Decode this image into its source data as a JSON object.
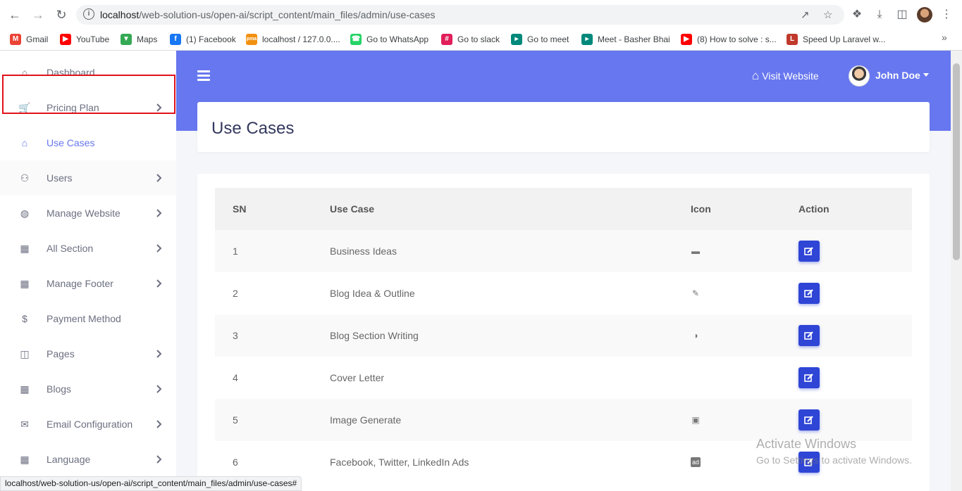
{
  "browser": {
    "url_host": "localhost",
    "url_path": "/web-solution-us/open-ai/script_content/main_files/admin/use-cases",
    "bookmarks": [
      {
        "label": "Gmail",
        "icon": "gmail-icon",
        "color": "#ea4335"
      },
      {
        "label": "YouTube",
        "icon": "youtube-icon",
        "color": "#ff0000"
      },
      {
        "label": "Maps",
        "icon": "maps-icon",
        "color": "#34a853"
      },
      {
        "label": "(1) Facebook",
        "icon": "facebook-icon",
        "color": "#1877f2"
      },
      {
        "label": "localhost / 127.0.0....",
        "icon": "phpmyadmin-icon",
        "color": "#f29111"
      },
      {
        "label": "Go to WhatsApp",
        "icon": "whatsapp-icon",
        "color": "#25d366"
      },
      {
        "label": "Go to slack",
        "icon": "slack-icon",
        "color": "#e01e5a"
      },
      {
        "label": "Go to meet",
        "icon": "meet-icon",
        "color": "#00897b"
      },
      {
        "label": "Meet - Basher Bhai",
        "icon": "meet-icon",
        "color": "#00897b"
      },
      {
        "label": "(8) How to solve : s...",
        "icon": "youtube-icon",
        "color": "#ff0000"
      },
      {
        "label": "Speed Up Laravel w...",
        "icon": "laravel-icon",
        "color": "#c0392b"
      }
    ],
    "status_url": "localhost/web-solution-us/open-ai/script_content/main_files/admin/use-cases#"
  },
  "sidebar": {
    "items": [
      {
        "label": "Dashboard",
        "icon": "home-icon",
        "has_submenu": false,
        "active": false
      },
      {
        "label": "Pricing Plan",
        "icon": "cart-icon",
        "has_submenu": true,
        "active": false
      },
      {
        "label": "Use Cases",
        "icon": "home-icon",
        "has_submenu": false,
        "active": true
      },
      {
        "label": "Users",
        "icon": "users-icon",
        "has_submenu": true,
        "active": false
      },
      {
        "label": "Manage Website",
        "icon": "globe-icon",
        "has_submenu": true,
        "active": false
      },
      {
        "label": "All Section",
        "icon": "grid-icon",
        "has_submenu": true,
        "active": false
      },
      {
        "label": "Manage Footer",
        "icon": "grid-icon",
        "has_submenu": true,
        "active": false
      },
      {
        "label": "Payment Method",
        "icon": "dollar-icon",
        "has_submenu": false,
        "active": false
      },
      {
        "label": "Pages",
        "icon": "columns-icon",
        "has_submenu": true,
        "active": false
      },
      {
        "label": "Blogs",
        "icon": "grid-icon",
        "has_submenu": true,
        "active": false
      },
      {
        "label": "Email Configuration",
        "icon": "envelope-icon",
        "has_submenu": true,
        "active": false
      },
      {
        "label": "Language",
        "icon": "grid-icon",
        "has_submenu": true,
        "active": false
      }
    ]
  },
  "header": {
    "visit_label": "Visit Website",
    "user_name": "John Doe",
    "accent_color": "#6777ef"
  },
  "page": {
    "title": "Use Cases"
  },
  "table": {
    "headers": [
      "SN",
      "Use Case",
      "Icon",
      "Action"
    ],
    "rows": [
      {
        "sn": "1",
        "use_case": "Business Ideas",
        "icon": "briefcase-icon"
      },
      {
        "sn": "2",
        "use_case": "Blog Idea & Outline",
        "icon": "edit-icon"
      },
      {
        "sn": "3",
        "use_case": "Blog Section Writing",
        "icon": "blog-icon"
      },
      {
        "sn": "4",
        "use_case": "Cover Letter",
        "icon": ""
      },
      {
        "sn": "5",
        "use_case": "Image Generate",
        "icon": "image-icon"
      },
      {
        "sn": "6",
        "use_case": "Facebook, Twitter, LinkedIn Ads",
        "icon": "ad-icon"
      }
    ],
    "edit_button_color": "#2f45d6"
  },
  "watermark": {
    "line1": "Activate Windows",
    "line2": "Go to Settings to activate Windows."
  }
}
